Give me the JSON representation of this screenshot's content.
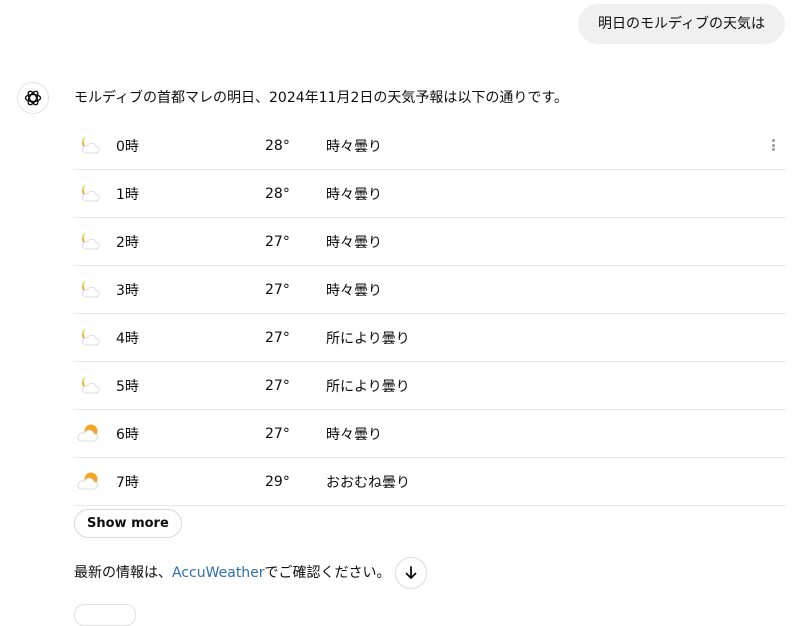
{
  "user_message": "明日のモルディブの天気は",
  "assistant": {
    "intro": "モルディブの首都マレの明日、2024年11月2日の天気予報は以下の通りです。",
    "forecast": [
      {
        "time": "0時",
        "temp": "28°",
        "condition": "時々曇り",
        "icon": "moon-cloud-icon"
      },
      {
        "time": "1時",
        "temp": "28°",
        "condition": "時々曇り",
        "icon": "moon-cloud-icon"
      },
      {
        "time": "2時",
        "temp": "27°",
        "condition": "時々曇り",
        "icon": "moon-cloud-icon"
      },
      {
        "time": "3時",
        "temp": "27°",
        "condition": "時々曇り",
        "icon": "moon-cloud-icon"
      },
      {
        "time": "4時",
        "temp": "27°",
        "condition": "所により曇り",
        "icon": "moon-cloud-icon"
      },
      {
        "time": "5時",
        "temp": "27°",
        "condition": "所により曇り",
        "icon": "moon-cloud-icon"
      },
      {
        "time": "6時",
        "temp": "27°",
        "condition": "時々曇り",
        "icon": "sun-cloud-icon"
      },
      {
        "time": "7時",
        "temp": "29°",
        "condition": "おおむね曇り",
        "icon": "sun-cloud-icon"
      }
    ],
    "show_more_label": "Show more",
    "footer_prefix": "最新の情報は、",
    "footer_link": "AccuWeather",
    "footer_suffix": "でご確認ください。"
  },
  "colors": {
    "bubble_bg": "#f0f0f0",
    "link": "#2f6fad",
    "icon_orange": "#f5a623",
    "divider": "#e8e8e8"
  }
}
